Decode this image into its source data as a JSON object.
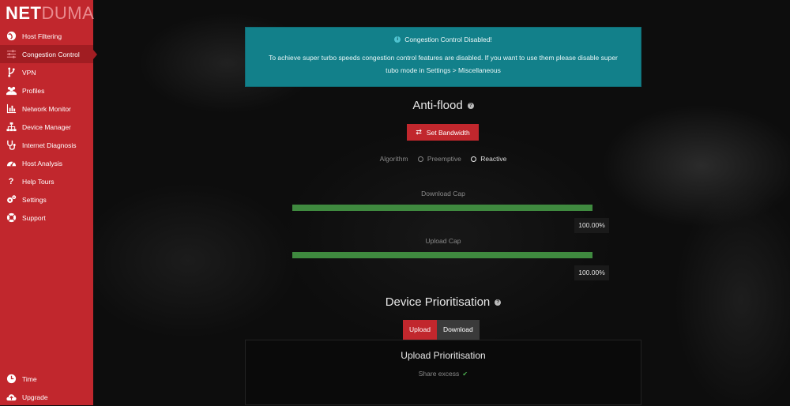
{
  "brand": {
    "part1": "NET",
    "part2": "DUMA"
  },
  "sidebar": {
    "items": [
      {
        "label": "Host Filtering",
        "icon": "globe-icon"
      },
      {
        "label": "Congestion Control",
        "icon": "sliders-icon",
        "active": true
      },
      {
        "label": "VPN",
        "icon": "fork-icon"
      },
      {
        "label": "Profiles",
        "icon": "users-icon"
      },
      {
        "label": "Network Monitor",
        "icon": "bar-chart-icon"
      },
      {
        "label": "Device Manager",
        "icon": "sitemap-icon"
      },
      {
        "label": "Internet Diagnosis",
        "icon": "stethoscope-icon"
      },
      {
        "label": "Host Analysis",
        "icon": "tachometer-icon"
      },
      {
        "label": "Help Tours",
        "icon": "question-icon"
      },
      {
        "label": "Settings",
        "icon": "gears-icon"
      },
      {
        "label": "Support",
        "icon": "lifebuoy-icon"
      }
    ],
    "bottom": [
      {
        "label": "Time",
        "icon": "clock-icon"
      },
      {
        "label": "Upgrade",
        "icon": "cloud-upload-icon"
      }
    ]
  },
  "alert": {
    "title": "Congestion Control Disabled!",
    "body": "To achieve super turbo speeds congestion control features are disabled. If you want to use them please disable super tubo mode in Settings > Miscellaneous"
  },
  "antiflood": {
    "title": "Anti-flood",
    "set_bandwidth_label": "Set Bandwidth",
    "algorithm_label": "Algorithm",
    "options": [
      "Preemptive",
      "Reactive"
    ],
    "selected": "Reactive",
    "download_label": "Download Cap",
    "download_value": "100.00%",
    "download_fraction": 1.0,
    "upload_label": "Upload Cap",
    "upload_value": "100.00%",
    "upload_fraction": 1.0
  },
  "prioritisation": {
    "title": "Device Prioritisation",
    "tabs": [
      "Upload",
      "Download"
    ],
    "active_tab": "Upload",
    "panel_title": "Upload Prioritisation",
    "share_excess_label": "Share excess",
    "share_excess_checked": true
  },
  "colors": {
    "brand_red": "#c1272d",
    "alert_teal": "#12808a",
    "bar_green": "#3f8a3f"
  }
}
